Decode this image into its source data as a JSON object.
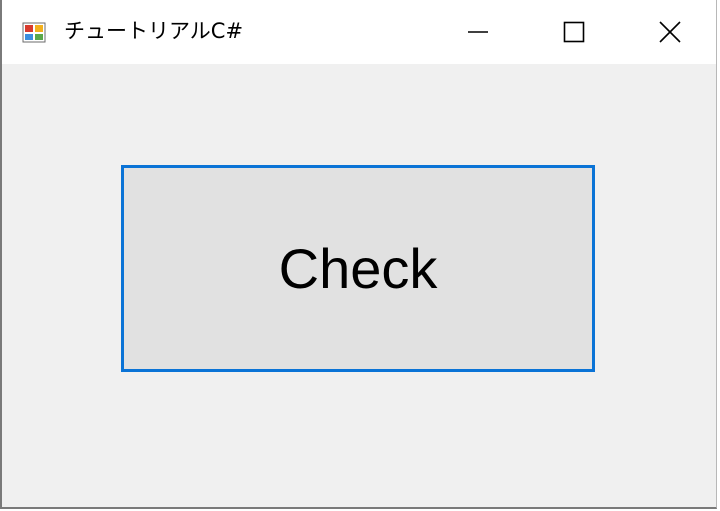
{
  "window": {
    "title": "チュートリアルC#",
    "icons": {
      "app": "app-icon",
      "minimize": "minimize-icon",
      "maximize": "maximize-icon",
      "close": "close-icon"
    }
  },
  "form": {
    "check_button_label": "Check"
  },
  "colors": {
    "accent": "#0a73d6",
    "button_face": "#e1e1e1",
    "form_background": "#f0f0f0",
    "titlebar_background": "#ffffff"
  }
}
